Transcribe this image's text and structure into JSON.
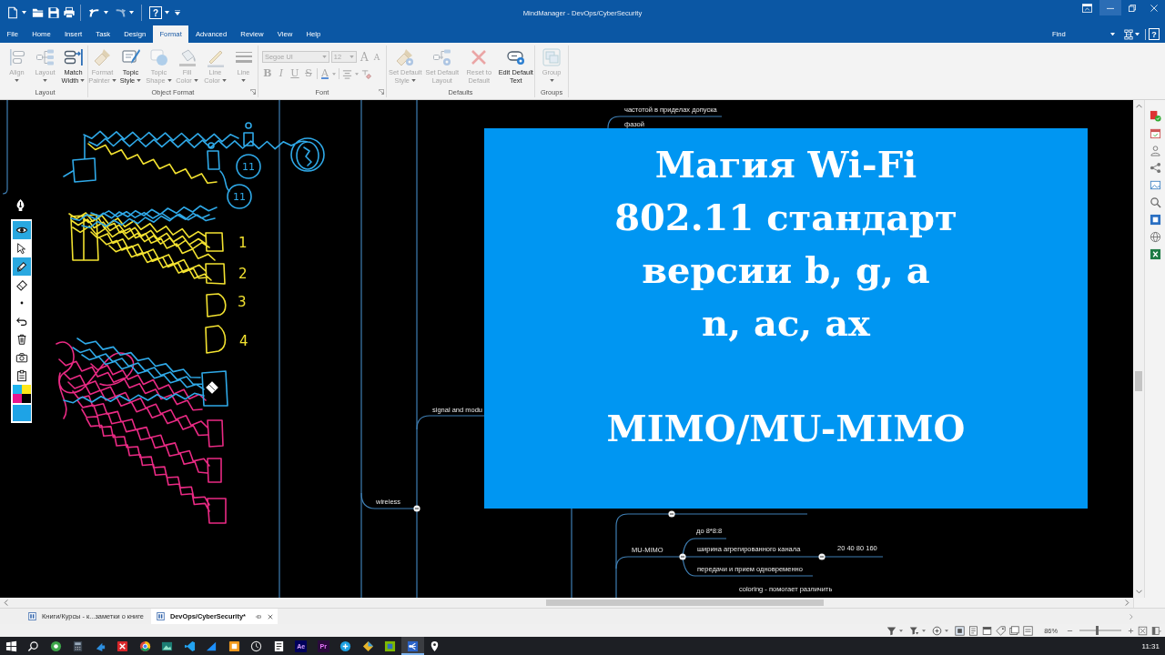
{
  "window": {
    "title": "MindManager - DevOps/CyberSecurity",
    "minimize_hovered": true
  },
  "quick_access": {
    "help_label": "?"
  },
  "ribbon_tabs": [
    {
      "label": "File",
      "selected": false
    },
    {
      "label": "Home",
      "selected": false
    },
    {
      "label": "Insert",
      "selected": false
    },
    {
      "label": "Task",
      "selected": false
    },
    {
      "label": "Design",
      "selected": false
    },
    {
      "label": "Format",
      "selected": true
    },
    {
      "label": "Advanced",
      "selected": false
    },
    {
      "label": "Review",
      "selected": false
    },
    {
      "label": "View",
      "selected": false
    },
    {
      "label": "Help",
      "selected": false
    }
  ],
  "find": {
    "placeholder": "Find"
  },
  "help_button": {
    "label": "?"
  },
  "ribbon_groups": [
    {
      "title": "Layout",
      "kind": "commands",
      "launcher": false,
      "commands": [
        {
          "label": "Align",
          "disabled": true,
          "dropdown": true
        },
        {
          "label": "Layout",
          "disabled": true,
          "dropdown": true
        },
        {
          "label": "Match Width",
          "disabled": false,
          "dropdown": true
        }
      ]
    },
    {
      "title": "Object Format",
      "kind": "commands",
      "launcher": true,
      "commands": [
        {
          "label": "Format Painter",
          "disabled": true,
          "dropdown": true
        },
        {
          "label": "Topic Style",
          "disabled": false,
          "dropdown": true
        },
        {
          "label": "Topic Shape",
          "disabled": true,
          "dropdown": true
        },
        {
          "label": "Fill Color",
          "disabled": true,
          "dropdown": true
        },
        {
          "label": "Line Color",
          "disabled": true,
          "dropdown": true
        },
        {
          "label": "Line",
          "disabled": true,
          "dropdown": true
        }
      ]
    },
    {
      "title": "Font",
      "kind": "font",
      "launcher": true,
      "font_name": {
        "value": "Segoe UI",
        "disabled": true
      },
      "font_size": {
        "value": "12",
        "disabled": true
      },
      "size_buttons": [
        {
          "label": "A",
          "kind": "grow",
          "disabled": true
        },
        {
          "label": "A",
          "kind": "shrink",
          "disabled": true
        }
      ],
      "format_buttons": [
        {
          "label": "B",
          "kind": "bold",
          "disabled": true
        },
        {
          "label": "I",
          "kind": "italic",
          "disabled": true
        },
        {
          "label": "U",
          "kind": "underline",
          "disabled": true
        },
        {
          "label": "S",
          "kind": "strike",
          "disabled": true
        },
        {
          "label": "A",
          "kind": "color",
          "disabled": true
        }
      ]
    },
    {
      "title": "Defaults",
      "kind": "commands",
      "launcher": false,
      "commands": [
        {
          "label": "Set Default Style",
          "disabled": true,
          "dropdown": true
        },
        {
          "label": "Set Default Layout",
          "disabled": true,
          "dropdown": false
        },
        {
          "label": "Reset to Default",
          "disabled": true,
          "dropdown": false
        },
        {
          "label": "Edit Default Text",
          "disabled": false,
          "dropdown": false
        }
      ]
    },
    {
      "title": "Groups",
      "kind": "commands",
      "launcher": false,
      "commands": [
        {
          "label": "Group",
          "disabled": true,
          "dropdown": true
        }
      ]
    }
  ],
  "canvas": {
    "topics": [
      {
        "text": "частотой в приделах допуска"
      },
      {
        "text": "фазой"
      },
      {
        "text": "signal and modu"
      },
      {
        "text": "wireless"
      },
      {
        "text": "MU-MIMO"
      },
      {
        "text": "до 8*8:8"
      },
      {
        "text": "ширина агрегированного канала"
      },
      {
        "text": "20 40 80 160"
      },
      {
        "text": "передачи и прием одновременно"
      },
      {
        "text": "coloring - помогает различить"
      }
    ],
    "ink_numbers": [
      {
        "text": "1"
      },
      {
        "text": "2"
      },
      {
        "text": "3"
      },
      {
        "text": "4"
      }
    ],
    "ink_circle_labels": [
      {
        "text": "11"
      },
      {
        "text": "11"
      }
    ]
  },
  "ink_toolbar": {
    "tools": [
      {
        "selected": true
      },
      {
        "selected": false
      },
      {
        "selected": true
      },
      {
        "selected": false
      },
      {
        "selected": false
      },
      {
        "selected": false
      },
      {
        "selected": false
      },
      {
        "selected": false
      },
      {
        "selected": false
      }
    ],
    "palette": [
      {
        "color": "#1fb4ee"
      },
      {
        "color": "#ffe81a"
      },
      {
        "color": "#e8158c"
      },
      {
        "color": "#000000"
      }
    ],
    "current_color": {
      "color": "#1ea3e6"
    }
  },
  "slide": {
    "paragraphs": [
      [
        "Магия Wi-Fi",
        "802.11 стандарт",
        "версии b, g, a",
        "n, ac, ax"
      ],
      [
        "MIMO/MU-MIMO"
      ]
    ]
  },
  "documents": [
    {
      "title": "Книги/Курсы - к...заметки о книге",
      "selected": false
    },
    {
      "title": "DevOps/CyberSecurity*",
      "selected": true
    }
  ],
  "status_bar": {
    "zoom": {
      "reading": "86%",
      "level": 0.42
    }
  },
  "taskbar": {
    "lettered_apps": [
      {
        "label": "Ae"
      },
      {
        "label": "Pr"
      }
    ],
    "clock": "11:31"
  }
}
